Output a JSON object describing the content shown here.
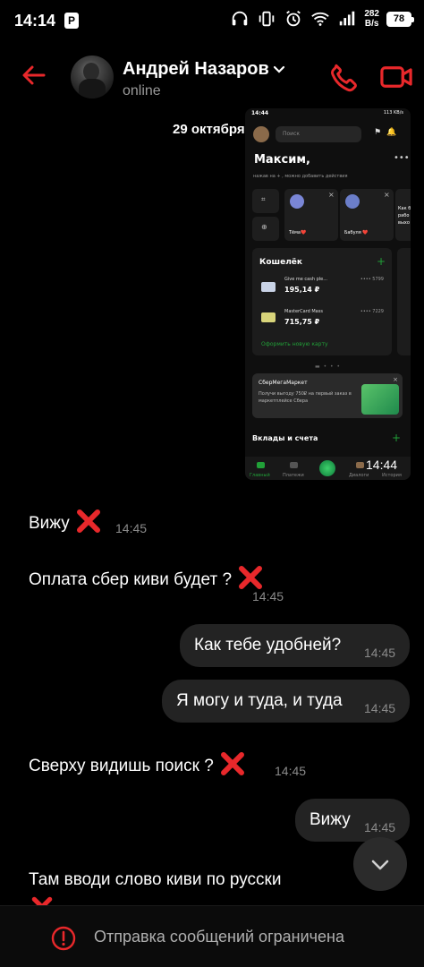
{
  "status_bar": {
    "time": "14:14",
    "p_badge": "P",
    "data_rate_value": "282",
    "data_rate_unit": "B/s",
    "battery": "78"
  },
  "header": {
    "contact_name": "Андрей Назаров",
    "status": "online"
  },
  "chat": {
    "date": "29 октября",
    "shared_image": {
      "time": "14:44",
      "status_time": "14:44",
      "status_icons": "113 KB/s",
      "search_placeholder": "Поиск",
      "greeting": "Максим,",
      "hint": "нажав на + , можно добавить действия",
      "tiles": [
        "Тёма❤️",
        "Бабуля ❤️",
        "Как б рабо выхо"
      ],
      "wallet_title": "Кошелёк",
      "cards": [
        {
          "name": "Give me cash ple...",
          "amount": "195,14 ₽",
          "number": "•••• 5799",
          "color": "#c9d3e6"
        },
        {
          "name": "MasterCard Mass",
          "amount": "715,75 ₽",
          "number": "•••• 7229",
          "color": "#d8d47a"
        }
      ],
      "wallet_link": "Оформить новую карту",
      "promo_title": "СберМегаМаркет",
      "promo_text": "Получи выгоду 750₽ на первый заказ в маркетплейсе Сбера",
      "deposits": "Вклады и счета",
      "nav": [
        "Главный",
        "Платежи",
        "Диалоги",
        "История"
      ]
    },
    "messages": [
      {
        "direction": "in",
        "text": "Вижу",
        "time": "14:45"
      },
      {
        "direction": "in",
        "text": "Оплата сбер киви будет ?",
        "time": "14:45"
      },
      {
        "direction": "out",
        "text": "Как тебе удобней?",
        "time": "14:45"
      },
      {
        "direction": "out",
        "text": "Я могу и туда, и туда",
        "time": "14:45"
      },
      {
        "direction": "in",
        "text": "Сверху видишь поиск ?",
        "time": "14:45"
      },
      {
        "direction": "out",
        "text": "Вижу",
        "time": "14:45"
      },
      {
        "direction": "in",
        "text": "Там вводи слово киви по русски",
        "time": ""
      }
    ]
  },
  "footer": {
    "text": "Отправка сообщений ограничена"
  },
  "colors": {
    "accent_red": "#e8282b",
    "outgoing_bubble": "#232323",
    "background": "#000000",
    "sber_green": "#21a038"
  }
}
